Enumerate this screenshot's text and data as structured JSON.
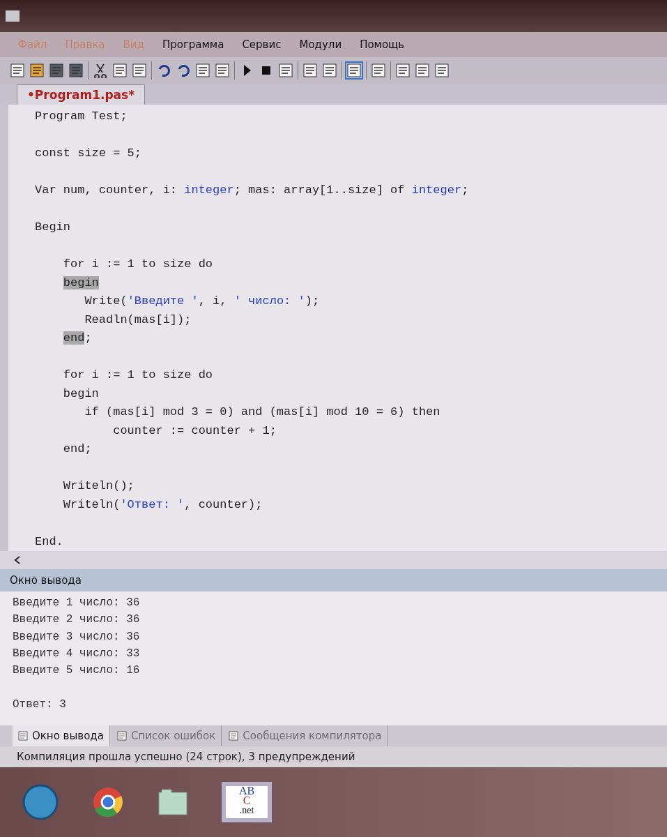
{
  "menu": [
    {
      "label": "Файл",
      "disabled": true
    },
    {
      "label": "Правка",
      "disabled": true
    },
    {
      "label": "Вид",
      "disabled": true
    },
    {
      "label": "Программа",
      "disabled": false
    },
    {
      "label": "Сервис",
      "disabled": false
    },
    {
      "label": "Модули",
      "disabled": false
    },
    {
      "label": "Помощь",
      "disabled": false
    }
  ],
  "editor_tab": {
    "label": "•Program1.pas*"
  },
  "code_lines": [
    {
      "space_before": false,
      "segments": [
        {
          "kind": "code",
          "text": "Program Test;"
        }
      ]
    },
    {
      "space_before": true,
      "segments": [
        {
          "kind": "code",
          "text": "const size = 5;"
        }
      ]
    },
    {
      "space_before": true,
      "segments": [
        {
          "kind": "code",
          "text": "Var num, counter, i: "
        },
        {
          "kind": "type",
          "text": "integer"
        },
        {
          "kind": "code",
          "text": "; mas: array[1..size] of "
        },
        {
          "kind": "type",
          "text": "integer"
        },
        {
          "kind": "code",
          "text": ";"
        }
      ]
    },
    {
      "space_before": true,
      "segments": [
        {
          "kind": "code",
          "text": "Begin"
        }
      ]
    },
    {
      "space_before": true,
      "segments": [
        {
          "kind": "code",
          "text": "    for i := 1 to size do"
        }
      ]
    },
    {
      "space_before": false,
      "segments": [
        {
          "kind": "match",
          "text": "    begin"
        }
      ]
    },
    {
      "space_before": false,
      "segments": [
        {
          "kind": "code",
          "text": "       Write("
        },
        {
          "kind": "string",
          "text": "'Введите '"
        },
        {
          "kind": "code",
          "text": ", i, "
        },
        {
          "kind": "string",
          "text": "' число: '"
        },
        {
          "kind": "code",
          "text": ");"
        }
      ]
    },
    {
      "space_before": false,
      "segments": [
        {
          "kind": "code",
          "text": "       Readln(mas[i]);"
        }
      ]
    },
    {
      "space_before": false,
      "segments": [
        {
          "kind": "match",
          "text": "    end"
        },
        {
          "kind": "code",
          "text": ";"
        }
      ]
    },
    {
      "space_before": true,
      "segments": [
        {
          "kind": "code",
          "text": "    for i := 1 to size do"
        }
      ]
    },
    {
      "space_before": false,
      "segments": [
        {
          "kind": "code",
          "text": "    begin"
        }
      ]
    },
    {
      "space_before": false,
      "segments": [
        {
          "kind": "code",
          "text": "       if (mas[i] mod 3 = 0) and (mas[i] mod 10 = 6) then"
        }
      ]
    },
    {
      "space_before": false,
      "segments": [
        {
          "kind": "code",
          "text": "           counter := counter + 1;"
        }
      ]
    },
    {
      "space_before": false,
      "segments": [
        {
          "kind": "code",
          "text": "    end;"
        }
      ]
    },
    {
      "space_before": true,
      "segments": [
        {
          "kind": "code",
          "text": "    Writeln();"
        }
      ]
    },
    {
      "space_before": false,
      "segments": [
        {
          "kind": "code",
          "text": "    Writeln("
        },
        {
          "kind": "string",
          "text": "'Ответ: '"
        },
        {
          "kind": "code",
          "text": ", counter);"
        }
      ]
    },
    {
      "space_before": true,
      "segments": [
        {
          "kind": "code",
          "text": "End."
        }
      ]
    }
  ],
  "output_panel": {
    "title": "Окно вывода",
    "lines": [
      {
        "text": "Введите 1 число: 36",
        "space_before": false
      },
      {
        "text": "Введите 2 число: 36",
        "space_before": false
      },
      {
        "text": "Введите 3 число: 36",
        "space_before": false
      },
      {
        "text": "Введите 4 число: 33",
        "space_before": false
      },
      {
        "text": "Введите 5 число: 16",
        "space_before": false
      },
      {
        "text": "Ответ: 3",
        "space_before": true
      }
    ]
  },
  "bottom_tabs": [
    {
      "label": "Окно вывода",
      "selected": true
    },
    {
      "label": "Список ошибок",
      "selected": false
    },
    {
      "label": "Сообщения компилятора",
      "selected": false
    }
  ],
  "status_bar": {
    "text": "Компиляция прошла успешно (24 строк), 3 предупреждений"
  },
  "taskbar": {
    "app_logo": {
      "top": "AB",
      "middle": "C",
      "bottom": ".net"
    }
  }
}
